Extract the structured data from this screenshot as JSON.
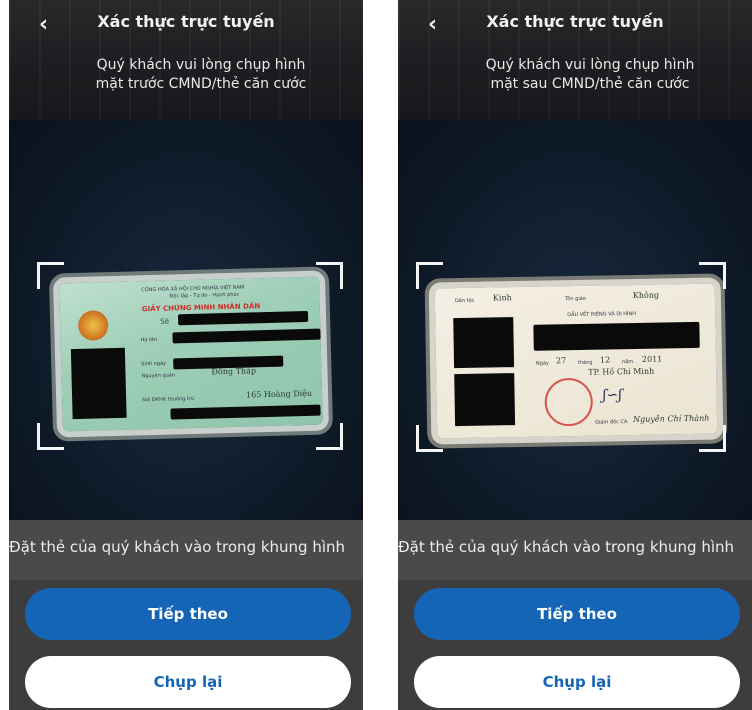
{
  "screens": [
    {
      "header": {
        "title": "Xác thực trực tuyến",
        "back_glyph": "‹"
      },
      "instruction": {
        "line1": "Quý khách vui lòng chụp hình",
        "line2": "mặt trước CMND/thẻ căn cước"
      },
      "card": {
        "side": "front",
        "header_line1": "CỘNG HÒA XÃ HỘI CHỦ NGHĨA VIỆT NAM",
        "header_line2": "Độc lập - Tự do - Hạnh phúc",
        "card_title": "GIẤY CHỨNG MINH NHÂN DÂN",
        "number_label": "Số",
        "name_label": "Họ tên",
        "dob_label": "Sinh ngày",
        "origin_label": "Nguyên quán",
        "origin_value": "Đồng Tháp",
        "residence_label": "Nơi ĐKHK thường trú",
        "residence_value": "165 Hoàng Diệu"
      },
      "hint": "Đặt thẻ của quý khách vào trong khung hình",
      "buttons": {
        "primary": "Tiếp theo",
        "secondary": "Chụp lại"
      }
    },
    {
      "header": {
        "title": "Xác thực trực tuyến",
        "back_glyph": "‹"
      },
      "instruction": {
        "line1": "Quý khách vui lòng chụp hình",
        "line2": "mặt sau CMND/thẻ căn cước"
      },
      "card": {
        "side": "back",
        "ethnicity_label": "Dân tộc",
        "ethnicity_value": "Kinh",
        "religion_label": "Tôn giáo",
        "religion_value": "Không",
        "marks_label": "DẤU VẾT RIÊNG VÀ DỊ HÌNH",
        "date_label": "Ngày",
        "date_day": "27",
        "date_month_label": "tháng",
        "date_month": "12",
        "date_year_label": "năm",
        "date_year": "2011",
        "place_value": "TP. Hồ Chí Minh",
        "signer_label": "Giám đốc CA",
        "signer_name": "Nguyễn Chí Thành"
      },
      "hint": "Đặt thẻ của quý khách vào trong khung hình",
      "buttons": {
        "primary": "Tiếp theo",
        "secondary": "Chụp lại"
      }
    }
  ],
  "colors": {
    "primary_blue": "#1565b6",
    "hint_bar": "#4a4a4a",
    "white": "#ffffff"
  },
  "icons": {
    "back": "chevron-left-icon",
    "frame": "scan-frame-corners"
  }
}
